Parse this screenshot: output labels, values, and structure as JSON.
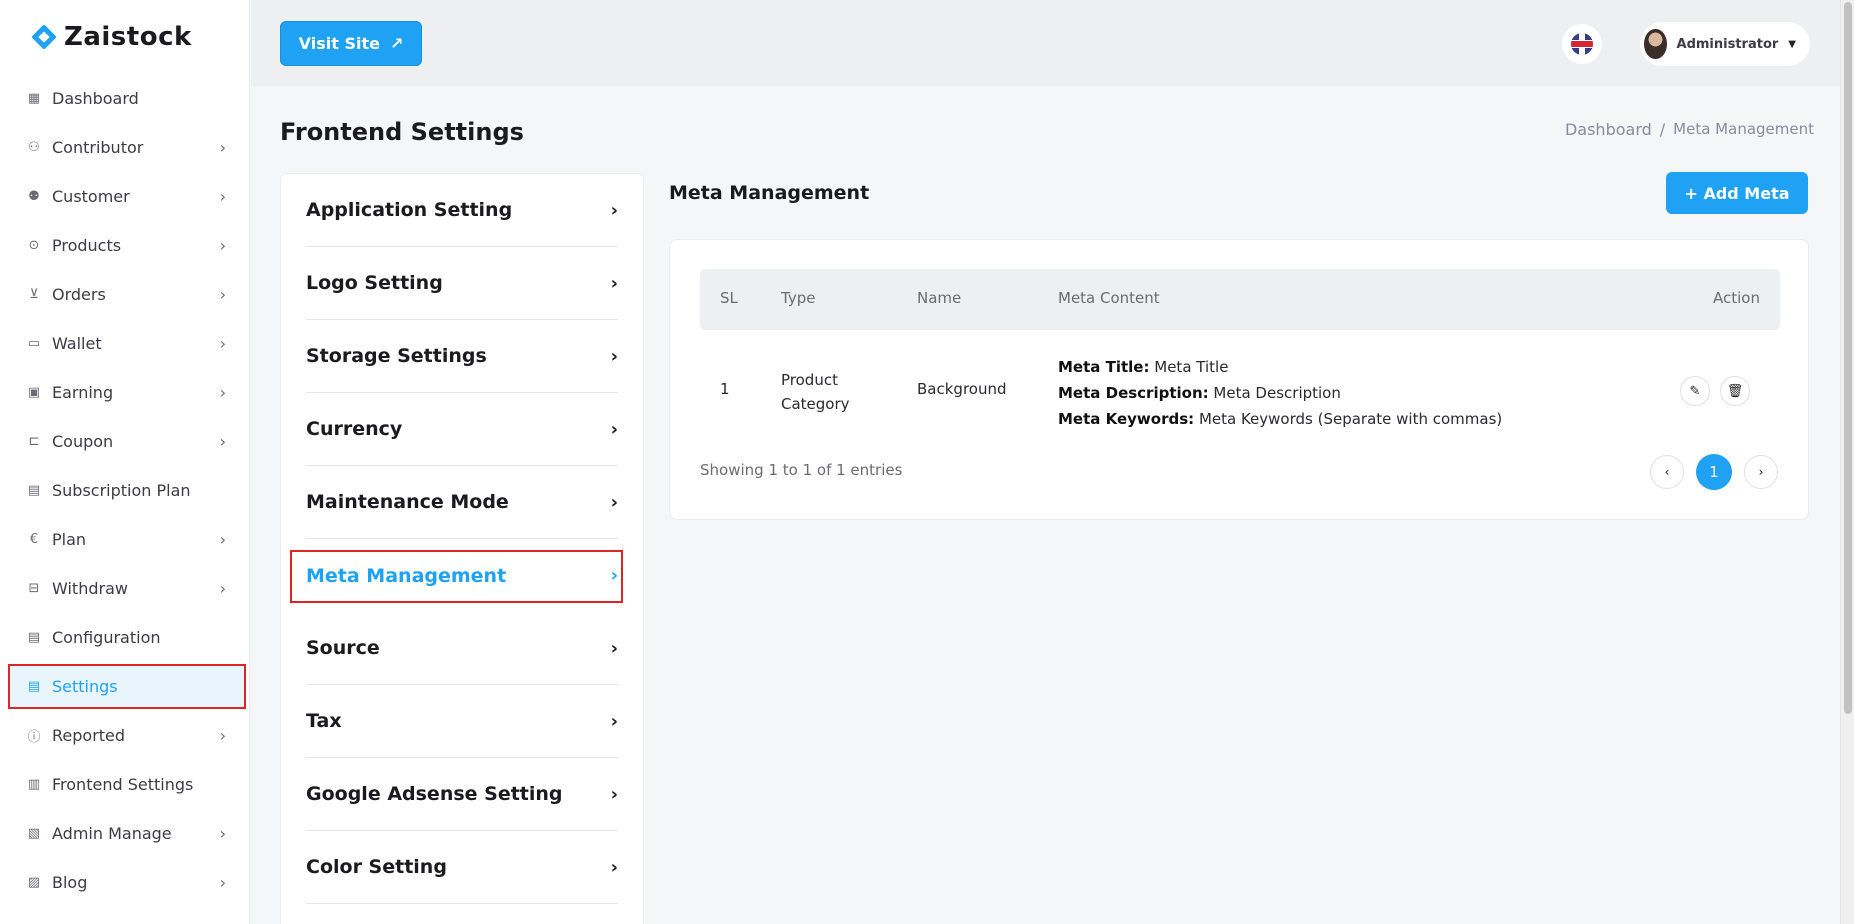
{
  "brand": {
    "name": "Zaistock"
  },
  "sidebar": {
    "items": [
      {
        "label": "Dashboard",
        "icon": "dashboard-icon",
        "glyph": "▦",
        "chevron": false
      },
      {
        "label": "Contributor",
        "icon": "user-pen-icon",
        "glyph": "⚇",
        "chevron": true
      },
      {
        "label": "Customer",
        "icon": "users-icon",
        "glyph": "⚉",
        "chevron": true
      },
      {
        "label": "Products",
        "icon": "products-icon",
        "glyph": "⊙",
        "chevron": true
      },
      {
        "label": "Orders",
        "icon": "cart-icon",
        "glyph": "⊻",
        "chevron": true
      },
      {
        "label": "Wallet",
        "icon": "wallet-icon",
        "glyph": "▭",
        "chevron": true
      },
      {
        "label": "Earning",
        "icon": "cash-icon",
        "glyph": "▣",
        "chevron": true
      },
      {
        "label": "Coupon",
        "icon": "coupon-icon",
        "glyph": "⊏",
        "chevron": true
      },
      {
        "label": "Subscription Plan",
        "icon": "subscription-icon",
        "glyph": "▤",
        "chevron": false
      },
      {
        "label": "Plan",
        "icon": "euro-icon",
        "glyph": "€",
        "chevron": true
      },
      {
        "label": "Withdraw",
        "icon": "withdraw-icon",
        "glyph": "⊟",
        "chevron": true
      },
      {
        "label": "Configuration",
        "icon": "configuration-icon",
        "glyph": "▤",
        "chevron": false
      },
      {
        "label": "Settings",
        "icon": "settings-icon",
        "glyph": "▤",
        "chevron": false,
        "active": true
      },
      {
        "label": "Reported",
        "icon": "report-icon",
        "glyph": "ⓘ",
        "chevron": true
      },
      {
        "label": "Frontend Settings",
        "icon": "frontend-icon",
        "glyph": "▥",
        "chevron": false
      },
      {
        "label": "Admin Manage",
        "icon": "admin-icon",
        "glyph": "▧",
        "chevron": true
      },
      {
        "label": "Blog",
        "icon": "blog-icon",
        "glyph": "▨",
        "chevron": true
      }
    ]
  },
  "topbar": {
    "visit_label": "Visit Site",
    "user_name": "Administrator",
    "language_icon": "uk-flag-icon"
  },
  "page": {
    "title": "Frontend Settings",
    "breadcrumb": [
      "Dashboard",
      "/",
      "Meta Management"
    ]
  },
  "settings_menu": [
    "Application Setting",
    "Logo Setting",
    "Storage Settings",
    "Currency",
    "Maintenance Mode",
    "Meta Management",
    "Source",
    "Tax",
    "Google Adsense Setting",
    "Color Setting"
  ],
  "settings_menu_active": "Meta Management",
  "meta": {
    "heading": "Meta Management",
    "add_label": "+ Add Meta",
    "columns": [
      "SL",
      "Type",
      "Name",
      "Meta Content",
      "Action"
    ],
    "rows": [
      {
        "sl": "1",
        "type": "Product Category",
        "name": "Background",
        "meta_title_label": "Meta Title:",
        "meta_title": "Meta Title",
        "meta_desc_label": "Meta Description:",
        "meta_desc": "Meta Description",
        "meta_keywords_label": "Meta Keywords:",
        "meta_keywords": "Meta Keywords (Separate with commas)"
      }
    ],
    "showing": "Showing 1 to 1 of 1 entries",
    "pagination": {
      "prev": "‹",
      "current": "1",
      "next": "›"
    }
  },
  "colors": {
    "accent": "#1fa2f3",
    "highlight": "#e02424"
  }
}
